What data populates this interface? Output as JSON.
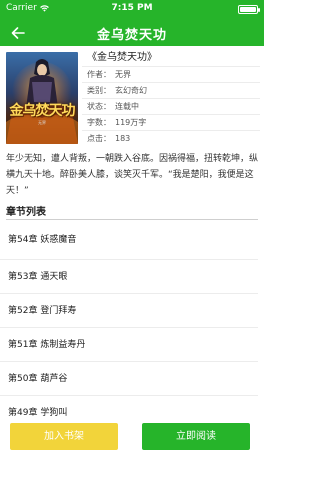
{
  "status": {
    "carrier": "Carrier",
    "time": "7:15 PM"
  },
  "nav": {
    "title": "金乌焚天功"
  },
  "book": {
    "cover_title": "金乌焚天功",
    "cover_author": "无界",
    "title": "《金乌焚天功》",
    "meta": [
      {
        "label": "作者：",
        "value": "无界"
      },
      {
        "label": "类别：",
        "value": "玄幻奇幻"
      },
      {
        "label": "状态：",
        "value": "连载中"
      },
      {
        "label": "字数：",
        "value": "119万字"
      },
      {
        "label": "点击：",
        "value": "183"
      }
    ],
    "description": "年少无知，遭人背叛，一朝跌入谷底。因祸得福，扭转乾坤，纵横九天十地。醉卧美人膝，谈笑灭千军。“我是楚阳，我便是这天！”"
  },
  "chapters": {
    "header": "章节列表",
    "items": [
      "第54章 妖惑魔音",
      "第53章 通天眼",
      "第52章 登门拜寿",
      "第51章 炼制益寿丹",
      "第50章 葫芦谷",
      "第49章 学狗叫"
    ]
  },
  "actions": {
    "add_shelf": "加入书架",
    "read_now": "立即阅读"
  },
  "colors": {
    "primary": "#26b42a",
    "shelf": "#f2d43a"
  }
}
